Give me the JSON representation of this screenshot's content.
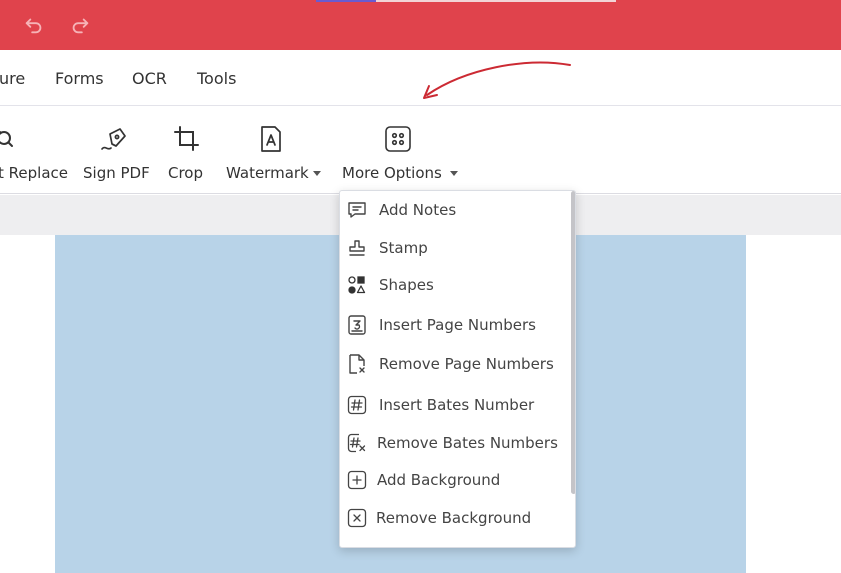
{
  "colors": {
    "title_bar": "#e0434c",
    "accent_arrow": "#cc2a33",
    "page_preview": "#b8d3e8"
  },
  "titlebar": {
    "undo_icon": "undo-icon",
    "redo_icon": "redo-icon"
  },
  "menubar": {
    "items": [
      "ure",
      "Forms",
      "OCR",
      "Tools"
    ]
  },
  "ribbon": {
    "tools": [
      {
        "label": "t Replace",
        "icon": "find-replace-icon"
      },
      {
        "label": "Sign PDF",
        "icon": "pen-signature-icon"
      },
      {
        "label": "Crop",
        "icon": "crop-icon"
      },
      {
        "label": "Watermark",
        "icon": "watermark-icon",
        "has_dropdown": true
      },
      {
        "label": "More Options",
        "icon": "more-options-grid-icon",
        "has_dropdown": true
      }
    ]
  },
  "more_options_menu": {
    "items": [
      {
        "label": "Add Notes",
        "icon": "note-icon"
      },
      {
        "label": "Stamp",
        "icon": "stamp-icon"
      },
      {
        "label": "Shapes",
        "icon": "shapes-icon"
      },
      {
        "label": "Insert Page Numbers",
        "icon": "insert-page-number-icon"
      },
      {
        "label": "Remove Page Numbers",
        "icon": "remove-page-number-icon"
      },
      {
        "label": "Insert Bates Number",
        "icon": "bates-number-icon"
      },
      {
        "label": "Remove Bates Numbers",
        "icon": "remove-bates-icon"
      },
      {
        "label": "Add Background",
        "icon": "add-background-icon"
      },
      {
        "label": "Remove Background",
        "icon": "remove-background-icon"
      }
    ]
  }
}
